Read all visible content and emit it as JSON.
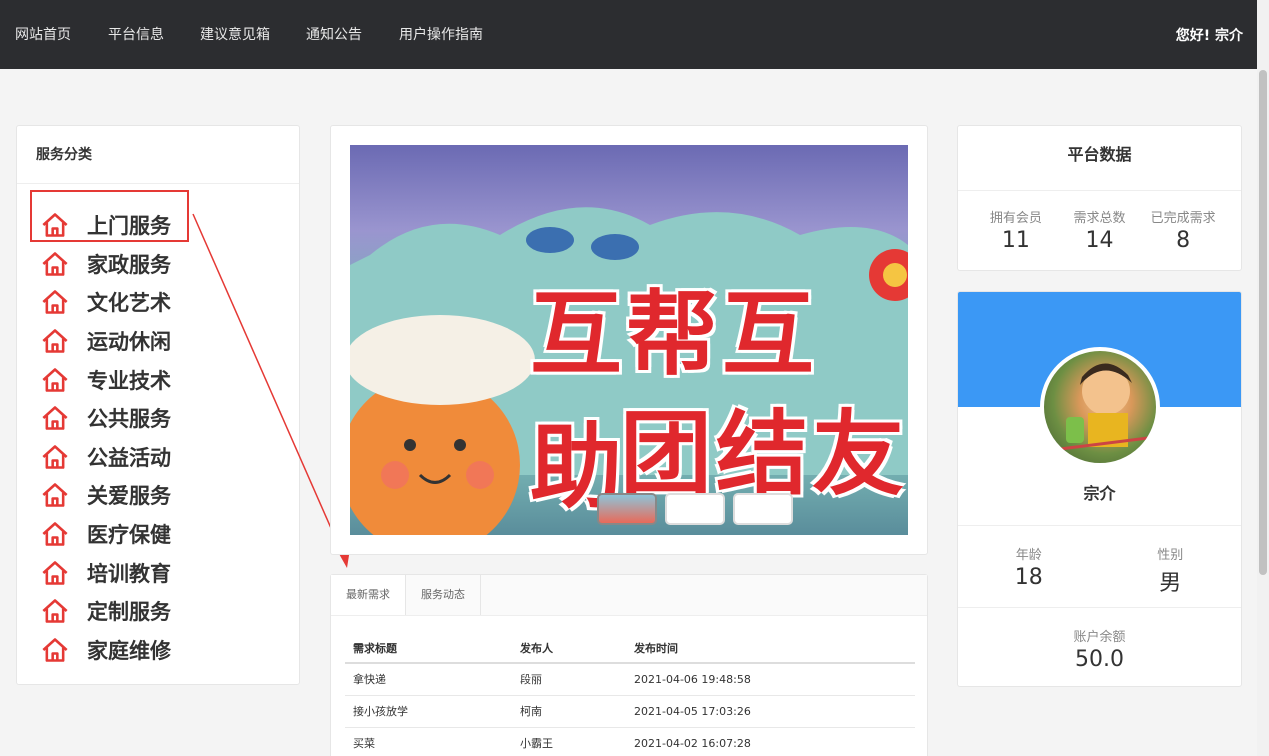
{
  "nav": {
    "items": [
      "网站首页",
      "平台信息",
      "建议意见箱",
      "通知公告",
      "用户操作指南"
    ],
    "greeting": "您好! 宗介"
  },
  "categories": {
    "title": "服务分类",
    "items": [
      "上门服务",
      "家政服务",
      "文化艺术",
      "运动休闲",
      "专业技术",
      "公共服务",
      "公益活动",
      "关爱服务",
      "医疗保健",
      "培训教育",
      "定制服务",
      "家庭维修"
    ],
    "icon": "home-icon",
    "icon_color": "#e53935"
  },
  "banner": {
    "line1": "互帮互助",
    "line2": "团结友"
  },
  "needs": {
    "tabs": [
      "最新需求",
      "服务动态"
    ],
    "columns": [
      "需求标题",
      "发布人",
      "发布时间"
    ],
    "rows": [
      [
        "拿快递",
        "段丽",
        "2021-04-06 19:48:58"
      ],
      [
        "接小孩放学",
        "柯南",
        "2021-04-05 17:03:26"
      ],
      [
        "买菜",
        "小霸王",
        "2021-04-02 16:07:28"
      ]
    ]
  },
  "platform": {
    "title": "平台数据",
    "members_label": "拥有会员",
    "members": "11",
    "demands_label": "需求总数",
    "demands": "14",
    "done_label": "已完成需求",
    "done": "8"
  },
  "profile": {
    "name": "宗介",
    "age_label": "年龄",
    "age": "18",
    "gender_label": "性别",
    "gender": "男",
    "balance_label": "账户余额",
    "balance": "50.0",
    "header_color": "#3b98f5"
  }
}
